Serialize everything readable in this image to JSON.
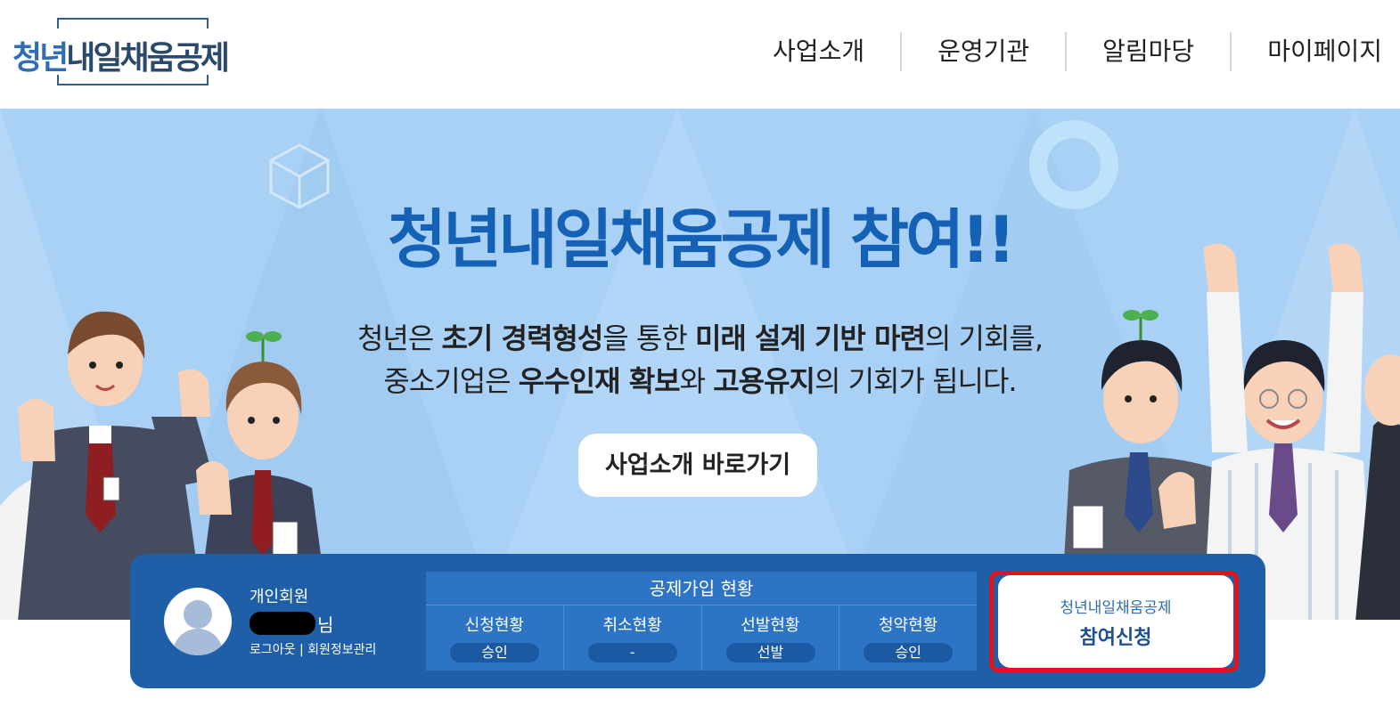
{
  "header": {
    "logo_prefix": "청년",
    "logo_rest": "내일채움공제",
    "nav": [
      "사업소개",
      "운영기관",
      "알림마당",
      "마이페이지"
    ]
  },
  "hero": {
    "title": "청년내일채움공제 참여!!",
    "line1": {
      "t1": "청년은 ",
      "b1": "초기 경력형성",
      "t2": "을 통한 ",
      "b2": "미래 설계 기반 마련",
      "t3": "의 기회를,"
    },
    "line2": {
      "t1": "중소기업은 ",
      "b1": "우수인재 확보",
      "t2": "와 ",
      "b2": "고용유지",
      "t3": "의 기회가 됩니다."
    },
    "button_label": "사업소개 바로가기"
  },
  "panel": {
    "member_type": "개인회원",
    "name_suffix": "님",
    "logout": "로그아웃",
    "divider": "|",
    "profile": "회원정보관리",
    "status_title": "공제가입 현황",
    "status": [
      {
        "label": "신청현황",
        "value": "승인"
      },
      {
        "label": "취소현황",
        "value": "-"
      },
      {
        "label": "선발현황",
        "value": "선발"
      },
      {
        "label": "청약현황",
        "value": "승인"
      }
    ],
    "apply_sub": "청년내일채움공제",
    "apply_main": "참여신청"
  },
  "colors": {
    "hero_bg": "#a9d0f5",
    "title_blue": "#1561b5",
    "panel_blue": "#1e5fa8",
    "highlight_red": "#e0131b"
  }
}
